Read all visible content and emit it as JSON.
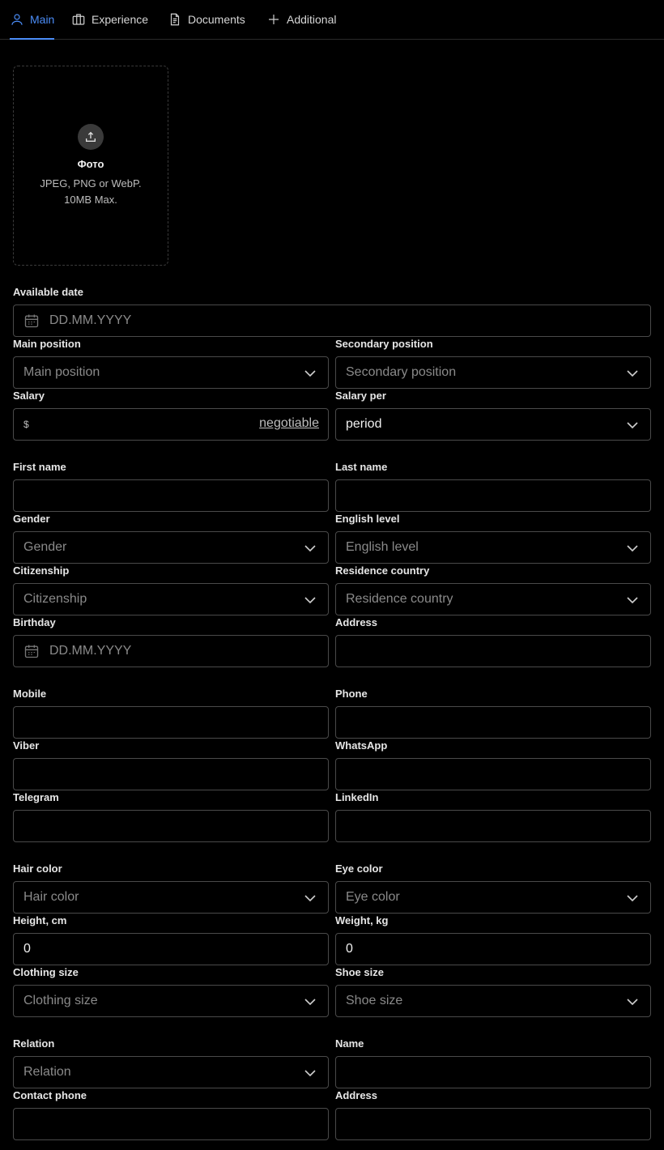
{
  "tabs": [
    {
      "label": "Main",
      "icon": "user-icon"
    },
    {
      "label": "Experience",
      "icon": "briefcase-icon"
    },
    {
      "label": "Documents",
      "icon": "document-icon"
    },
    {
      "label": "Additional",
      "icon": "plus-icon"
    }
  ],
  "photo": {
    "title": "Фото",
    "hint": "JPEG, PNG or WebP. 10MB Max."
  },
  "fields": {
    "available_date": {
      "label": "Available date",
      "placeholder": "DD.MM.YYYY"
    },
    "main_position": {
      "label": "Main position",
      "placeholder": "Main position"
    },
    "secondary_position": {
      "label": "Secondary position",
      "placeholder": "Secondary position"
    },
    "salary": {
      "label": "Salary",
      "currency": "$",
      "negotiable": "negotiable"
    },
    "salary_per": {
      "label": "Salary per",
      "value": "period"
    },
    "first_name": {
      "label": "First name",
      "value": ""
    },
    "last_name": {
      "label": "Last name",
      "value": ""
    },
    "gender": {
      "label": "Gender",
      "placeholder": "Gender"
    },
    "english_level": {
      "label": "English level",
      "placeholder": "English level"
    },
    "citizenship": {
      "label": "Citizenship",
      "placeholder": "Citizenship"
    },
    "residence_country": {
      "label": "Residence country",
      "placeholder": "Residence country"
    },
    "birthday": {
      "label": "Birthday",
      "placeholder": "DD.MM.YYYY"
    },
    "address": {
      "label": "Address",
      "value": ""
    },
    "mobile": {
      "label": "Mobile",
      "value": ""
    },
    "phone": {
      "label": "Phone",
      "value": ""
    },
    "viber": {
      "label": "Viber",
      "value": ""
    },
    "whatsapp": {
      "label": "WhatsApp",
      "value": ""
    },
    "telegram": {
      "label": "Telegram",
      "value": ""
    },
    "linkedin": {
      "label": "LinkedIn",
      "value": ""
    },
    "hair_color": {
      "label": "Hair color",
      "placeholder": "Hair color"
    },
    "eye_color": {
      "label": "Eye color",
      "placeholder": "Eye color"
    },
    "height": {
      "label": "Height, cm",
      "value": "0"
    },
    "weight": {
      "label": "Weight, kg",
      "value": "0"
    },
    "clothing_size": {
      "label": "Clothing size",
      "placeholder": "Clothing size"
    },
    "shoe_size": {
      "label": "Shoe size",
      "placeholder": "Shoe size"
    },
    "relation": {
      "label": "Relation",
      "placeholder": "Relation"
    },
    "contact_name": {
      "label": "Name",
      "value": ""
    },
    "contact_phone": {
      "label": "Contact phone",
      "value": ""
    },
    "contact_address": {
      "label": "Address",
      "value": ""
    }
  },
  "colors": {
    "accent": "#4b8df8",
    "background": "#000000",
    "border": "#4a4a4a"
  }
}
